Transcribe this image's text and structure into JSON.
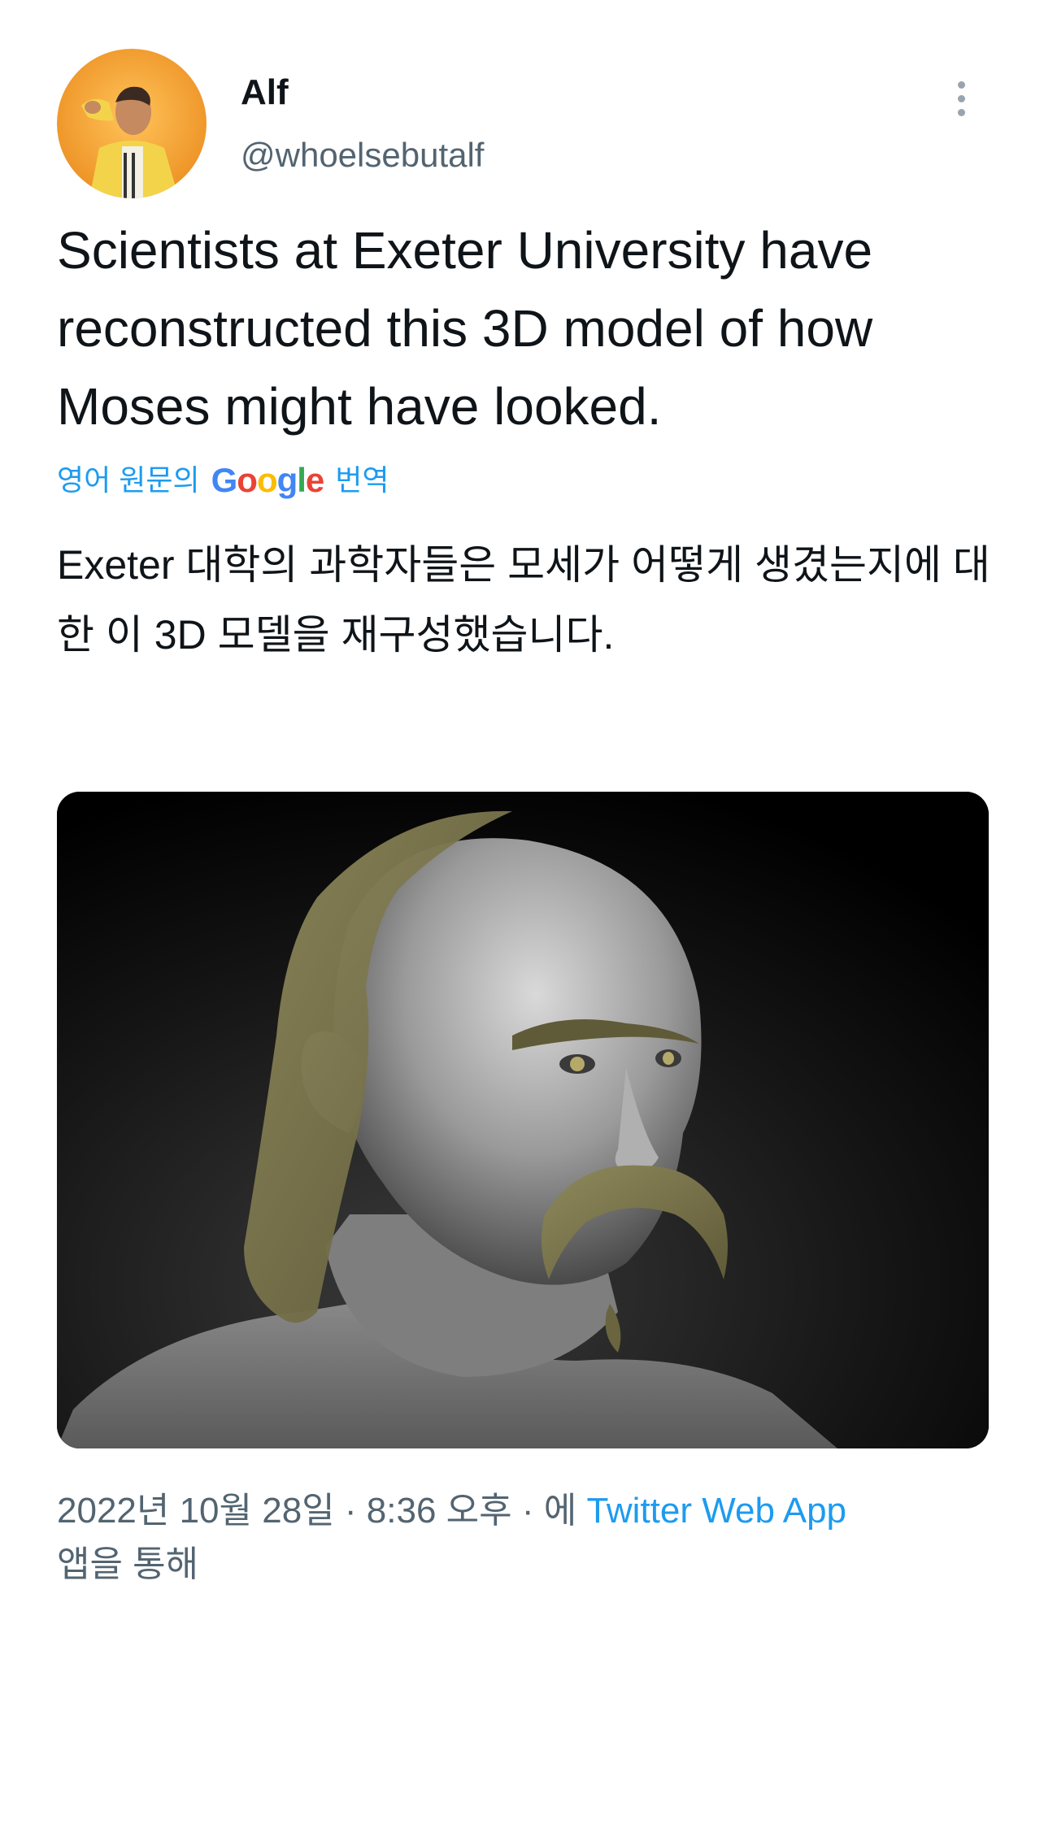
{
  "tweet": {
    "author_name": "Alf",
    "author_handle": "@whoelsebutalf",
    "text": "Scientists at Exeter University have reconstructed this 3D model of how Moses might have looked.",
    "translation_label_prefix": "영어 원문의",
    "translation_label_brand": "Google",
    "translation_label_suffix": "번역",
    "translated_text": "Exeter 대학의 과학자들은 모세가 어떻게 생겼는지에 대한 이 3D 모델을 재구성했습니다.",
    "date": "2022년 10월 28일",
    "time": "8:36 오후",
    "via_prefix": "에",
    "source_app": "Twitter Web App",
    "via_suffix": "앱을 통해"
  },
  "icons": {
    "more": "more-vertical-icon"
  },
  "colors": {
    "link": "#1d9bf0",
    "secondary_text": "#536471",
    "primary_text": "#0f1419",
    "avatar_bg": "#f2a43a"
  }
}
